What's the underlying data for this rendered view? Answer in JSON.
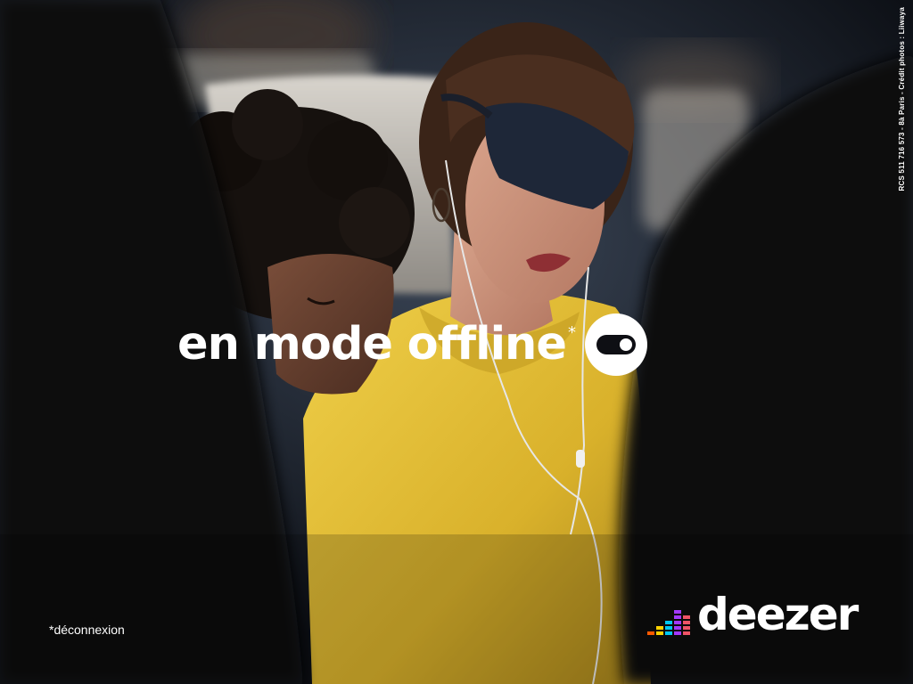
{
  "ad": {
    "headline": "en mode offline",
    "headline_asterisk": "*",
    "footnote": "*déconnexion",
    "credit_line": "RCS 511 716 573 - 8à Paris - Crédit photos : Liiwaya"
  },
  "brand": {
    "wordmark": "deezer",
    "equalizer_colors": [
      "#ff5a00",
      "#ffd200",
      "#00c7f2",
      "#a238ff",
      "#ef5466"
    ]
  },
  "toggle": {
    "state": "on",
    "icon": "toggle-switch-icon"
  },
  "colors": {
    "sweater_yellow": "#e8c23a",
    "background_dark": "#0b0d12",
    "text": "#ffffff"
  }
}
